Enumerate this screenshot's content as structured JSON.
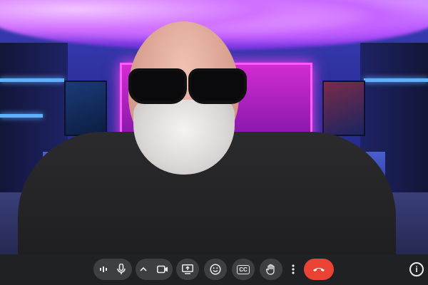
{
  "call": {
    "participant": {
      "description_icon": "participant-video"
    },
    "controls": {
      "audio_levels_icon": "audio-levels-icon",
      "mic_icon": "microphone-icon",
      "more_camera_options_icon": "chevron-up-icon",
      "camera_icon": "camera-icon",
      "present_icon": "present-screen-icon",
      "reactions_icon": "emoji-icon",
      "captions_label": "CC",
      "raise_hand_icon": "raise-hand-icon",
      "more_options_icon": "more-vertical-icon",
      "end_call_icon": "phone-hangup-icon",
      "info_label": "i"
    },
    "colors": {
      "bar_bg": "#202124",
      "button_bg": "#3c4043",
      "end_call": "#ea4335",
      "icon": "#e8eaed"
    }
  }
}
